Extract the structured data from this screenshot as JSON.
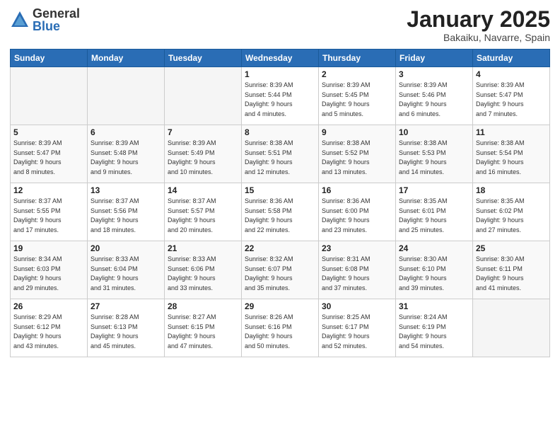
{
  "header": {
    "logo_general": "General",
    "logo_blue": "Blue",
    "month_title": "January 2025",
    "location": "Bakaiku, Navarre, Spain"
  },
  "days_of_week": [
    "Sunday",
    "Monday",
    "Tuesday",
    "Wednesday",
    "Thursday",
    "Friday",
    "Saturday"
  ],
  "weeks": [
    {
      "days": [
        {
          "num": "",
          "info": ""
        },
        {
          "num": "",
          "info": ""
        },
        {
          "num": "",
          "info": ""
        },
        {
          "num": "1",
          "info": "Sunrise: 8:39 AM\nSunset: 5:44 PM\nDaylight: 9 hours\nand 4 minutes."
        },
        {
          "num": "2",
          "info": "Sunrise: 8:39 AM\nSunset: 5:45 PM\nDaylight: 9 hours\nand 5 minutes."
        },
        {
          "num": "3",
          "info": "Sunrise: 8:39 AM\nSunset: 5:46 PM\nDaylight: 9 hours\nand 6 minutes."
        },
        {
          "num": "4",
          "info": "Sunrise: 8:39 AM\nSunset: 5:47 PM\nDaylight: 9 hours\nand 7 minutes."
        }
      ]
    },
    {
      "days": [
        {
          "num": "5",
          "info": "Sunrise: 8:39 AM\nSunset: 5:47 PM\nDaylight: 9 hours\nand 8 minutes."
        },
        {
          "num": "6",
          "info": "Sunrise: 8:39 AM\nSunset: 5:48 PM\nDaylight: 9 hours\nand 9 minutes."
        },
        {
          "num": "7",
          "info": "Sunrise: 8:39 AM\nSunset: 5:49 PM\nDaylight: 9 hours\nand 10 minutes."
        },
        {
          "num": "8",
          "info": "Sunrise: 8:38 AM\nSunset: 5:51 PM\nDaylight: 9 hours\nand 12 minutes."
        },
        {
          "num": "9",
          "info": "Sunrise: 8:38 AM\nSunset: 5:52 PM\nDaylight: 9 hours\nand 13 minutes."
        },
        {
          "num": "10",
          "info": "Sunrise: 8:38 AM\nSunset: 5:53 PM\nDaylight: 9 hours\nand 14 minutes."
        },
        {
          "num": "11",
          "info": "Sunrise: 8:38 AM\nSunset: 5:54 PM\nDaylight: 9 hours\nand 16 minutes."
        }
      ]
    },
    {
      "days": [
        {
          "num": "12",
          "info": "Sunrise: 8:37 AM\nSunset: 5:55 PM\nDaylight: 9 hours\nand 17 minutes."
        },
        {
          "num": "13",
          "info": "Sunrise: 8:37 AM\nSunset: 5:56 PM\nDaylight: 9 hours\nand 18 minutes."
        },
        {
          "num": "14",
          "info": "Sunrise: 8:37 AM\nSunset: 5:57 PM\nDaylight: 9 hours\nand 20 minutes."
        },
        {
          "num": "15",
          "info": "Sunrise: 8:36 AM\nSunset: 5:58 PM\nDaylight: 9 hours\nand 22 minutes."
        },
        {
          "num": "16",
          "info": "Sunrise: 8:36 AM\nSunset: 6:00 PM\nDaylight: 9 hours\nand 23 minutes."
        },
        {
          "num": "17",
          "info": "Sunrise: 8:35 AM\nSunset: 6:01 PM\nDaylight: 9 hours\nand 25 minutes."
        },
        {
          "num": "18",
          "info": "Sunrise: 8:35 AM\nSunset: 6:02 PM\nDaylight: 9 hours\nand 27 minutes."
        }
      ]
    },
    {
      "days": [
        {
          "num": "19",
          "info": "Sunrise: 8:34 AM\nSunset: 6:03 PM\nDaylight: 9 hours\nand 29 minutes."
        },
        {
          "num": "20",
          "info": "Sunrise: 8:33 AM\nSunset: 6:04 PM\nDaylight: 9 hours\nand 31 minutes."
        },
        {
          "num": "21",
          "info": "Sunrise: 8:33 AM\nSunset: 6:06 PM\nDaylight: 9 hours\nand 33 minutes."
        },
        {
          "num": "22",
          "info": "Sunrise: 8:32 AM\nSunset: 6:07 PM\nDaylight: 9 hours\nand 35 minutes."
        },
        {
          "num": "23",
          "info": "Sunrise: 8:31 AM\nSunset: 6:08 PM\nDaylight: 9 hours\nand 37 minutes."
        },
        {
          "num": "24",
          "info": "Sunrise: 8:30 AM\nSunset: 6:10 PM\nDaylight: 9 hours\nand 39 minutes."
        },
        {
          "num": "25",
          "info": "Sunrise: 8:30 AM\nSunset: 6:11 PM\nDaylight: 9 hours\nand 41 minutes."
        }
      ]
    },
    {
      "days": [
        {
          "num": "26",
          "info": "Sunrise: 8:29 AM\nSunset: 6:12 PM\nDaylight: 9 hours\nand 43 minutes."
        },
        {
          "num": "27",
          "info": "Sunrise: 8:28 AM\nSunset: 6:13 PM\nDaylight: 9 hours\nand 45 minutes."
        },
        {
          "num": "28",
          "info": "Sunrise: 8:27 AM\nSunset: 6:15 PM\nDaylight: 9 hours\nand 47 minutes."
        },
        {
          "num": "29",
          "info": "Sunrise: 8:26 AM\nSunset: 6:16 PM\nDaylight: 9 hours\nand 50 minutes."
        },
        {
          "num": "30",
          "info": "Sunrise: 8:25 AM\nSunset: 6:17 PM\nDaylight: 9 hours\nand 52 minutes."
        },
        {
          "num": "31",
          "info": "Sunrise: 8:24 AM\nSunset: 6:19 PM\nDaylight: 9 hours\nand 54 minutes."
        },
        {
          "num": "",
          "info": ""
        }
      ]
    }
  ]
}
